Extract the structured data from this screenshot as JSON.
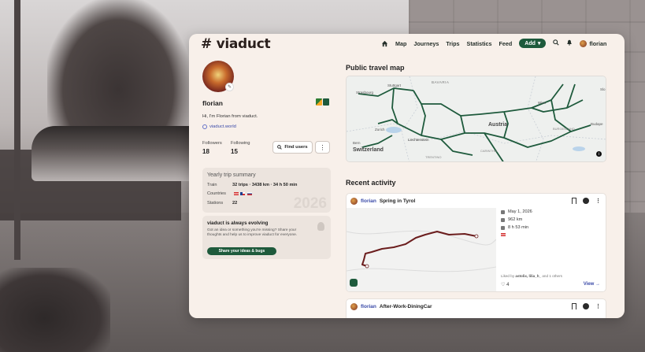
{
  "brand": "# viaduct",
  "nav": {
    "items": [
      "Map",
      "Journeys",
      "Trips",
      "Statistics",
      "Feed"
    ],
    "add_label": "Add",
    "user_label": "florian"
  },
  "profile": {
    "username": "florian",
    "bio": "Hi, I'm Florian from viaduct.",
    "website": "viaduct.world",
    "followers_label": "Followers",
    "followers": "18",
    "following_label": "Following",
    "following": "15",
    "find_users_label": "Find users"
  },
  "summary": {
    "title": "Yearly trip summary",
    "train_label": "Train",
    "train_value": "32 trips · 3438 km · 34 h 50 min",
    "countries_label": "Countries",
    "stations_label": "Stations",
    "stations_value": "22",
    "year": "2026"
  },
  "evolving": {
    "title": "viaduct is always evolving",
    "text": "Got an idea or something you're missing? Share your thoughts and help us to improve viaduct for everyone.",
    "button": "Share your ideas & bugs"
  },
  "map_section": {
    "title": "Public travel map",
    "labels": [
      "Strasbourg",
      "Stuttgart",
      "BAVARIA",
      "Wien",
      "Slo",
      "Zurich",
      "Bern",
      "Liechtenstein",
      "Austria",
      "Budape",
      "Switzerland",
      "BURGENLAND",
      "CARINTHIA",
      "TRENTINO"
    ]
  },
  "activity": {
    "title": "Recent activity",
    "cards": [
      {
        "user": "florian",
        "trip": "Spring in Tyrol",
        "date": "May 1, 2026",
        "distance": "962 km",
        "duration": "8 h 53 min",
        "liked_prefix": "Liked by",
        "liked_users": "astolix, lilia_h_",
        "liked_suffix": "and 1 others",
        "likes": "4",
        "view_label": "View →"
      },
      {
        "user": "florian",
        "trip": "After-Work-DiningCar"
      }
    ]
  },
  "colors": {
    "accent": "#1e5a3c",
    "link": "#3a4aa8",
    "panel": "#f8f0ea"
  }
}
